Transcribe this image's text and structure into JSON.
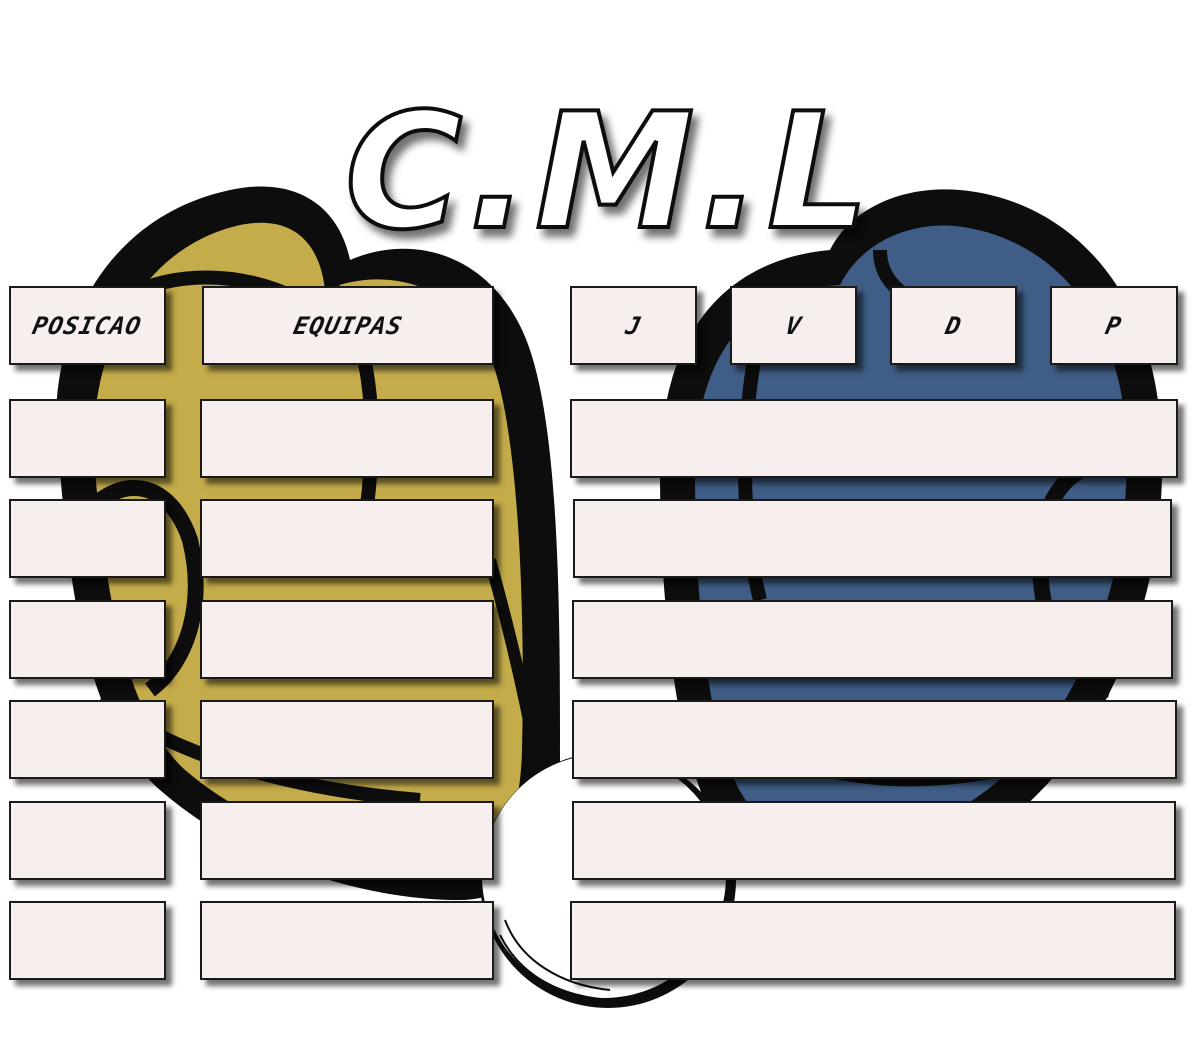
{
  "title": "C.M.L",
  "colors": {
    "cell_fill": "#f7eeee",
    "left_glove": "#c4ac4a",
    "right_glove": "#3f5d86",
    "outline": "#0d0d0d"
  },
  "headers": {
    "posicao": "POSICAO",
    "equipas": "EQUIPAS",
    "j": "J",
    "v": "V",
    "d": "D",
    "p": "P"
  },
  "rows": [
    {
      "posicao": "",
      "equipa": "",
      "stats": ""
    },
    {
      "posicao": "",
      "equipa": "",
      "stats": ""
    },
    {
      "posicao": "",
      "equipa": "",
      "stats": ""
    },
    {
      "posicao": "",
      "equipa": "",
      "stats": ""
    },
    {
      "posicao": "",
      "equipa": "",
      "stats": ""
    },
    {
      "posicao": "",
      "equipa": "",
      "stats": ""
    }
  ]
}
